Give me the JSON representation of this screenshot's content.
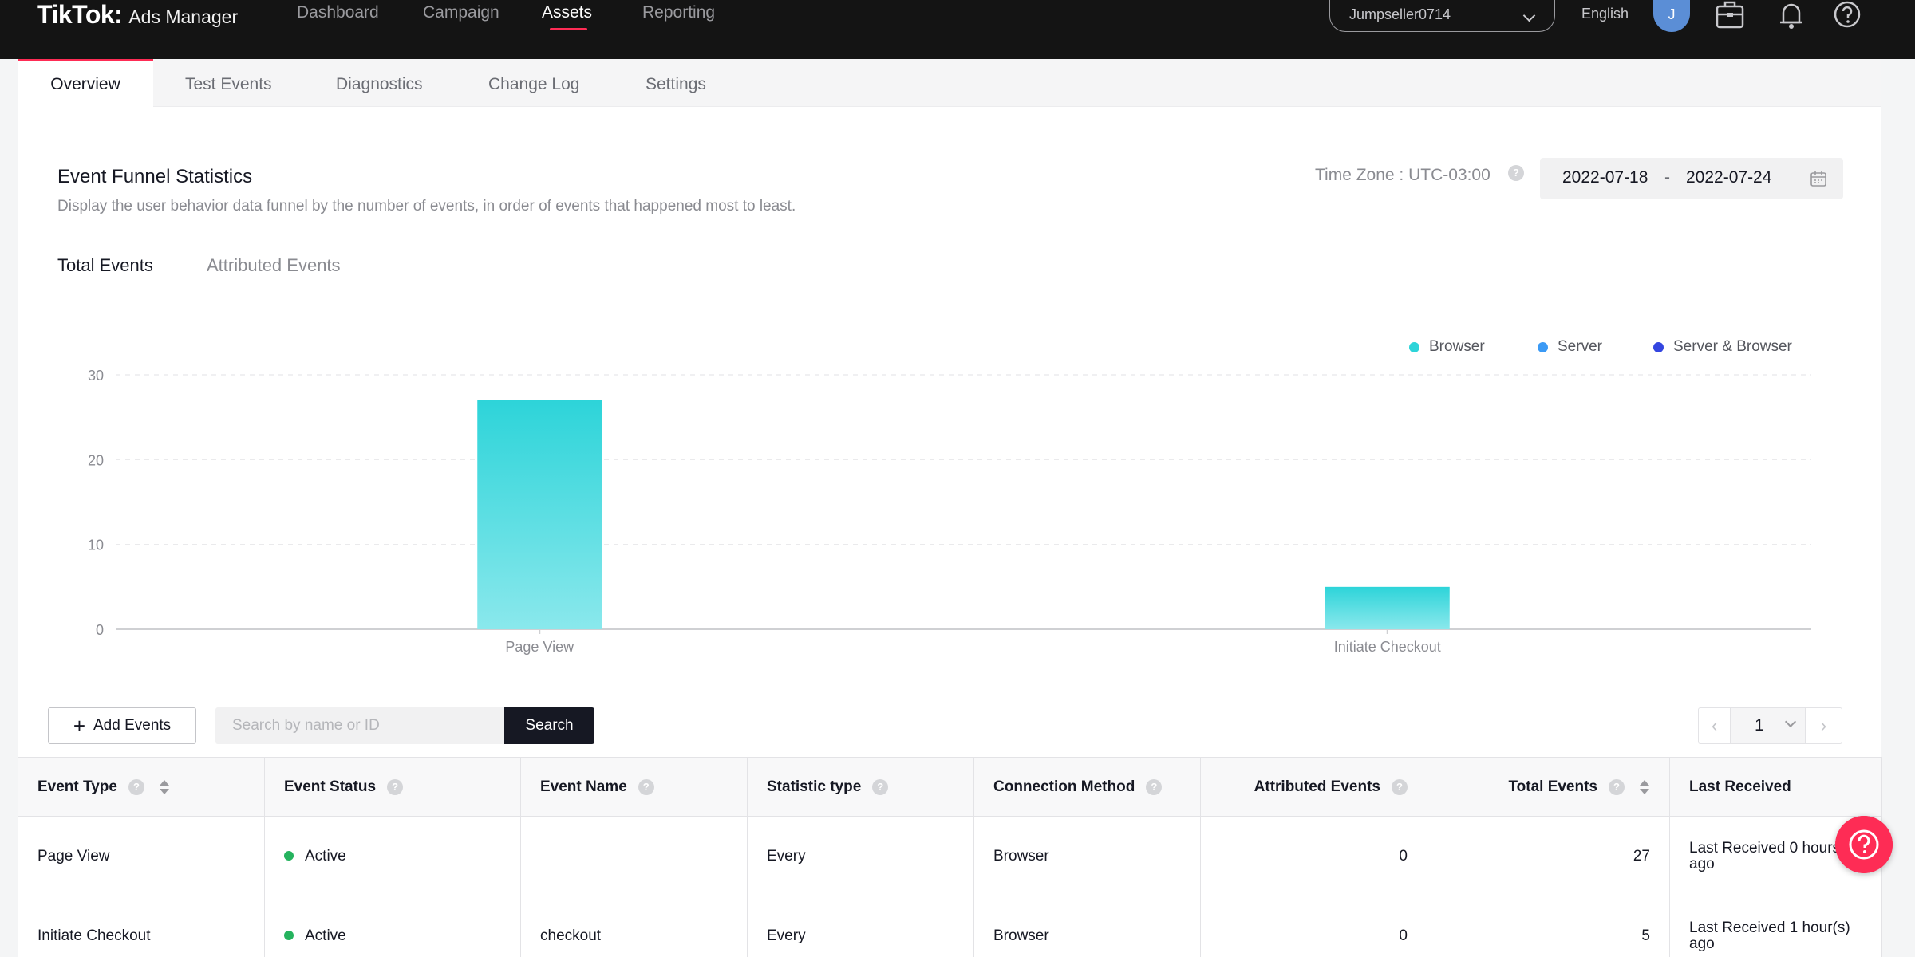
{
  "header": {
    "logo_main": "TikTok:",
    "logo_sub": "Ads Manager",
    "nav": [
      {
        "label": "Dashboard"
      },
      {
        "label": "Campaign"
      },
      {
        "label": "Assets"
      },
      {
        "label": "Reporting"
      }
    ],
    "active_nav": "Assets",
    "account": "Jumpseller0714",
    "language": "English",
    "avatar_initial": "J",
    "icons": [
      "briefcase-icon",
      "bell-icon",
      "help-circle-icon"
    ]
  },
  "tabs": [
    "Overview",
    "Test Events",
    "Diagnostics",
    "Change Log",
    "Settings"
  ],
  "active_tab": "Overview",
  "funnel": {
    "title": "Event Funnel Statistics",
    "description": "Display the user behavior data funnel by the number of events, in order of events that happened most to least.",
    "timezone": "Time Zone : UTC-03:00",
    "date_start": "2022-07-18",
    "date_sep": "-",
    "date_end": "2022-07-24",
    "subtabs": [
      "Total Events",
      "Attributed Events"
    ],
    "active_subtab": "Total Events"
  },
  "chart_data": {
    "type": "bar",
    "categories": [
      "Page View",
      "Initiate Checkout"
    ],
    "series": [
      {
        "name": "Browser",
        "values": [
          27,
          5
        ],
        "color": "#2dd4d9"
      },
      {
        "name": "Server",
        "values": [
          0,
          0
        ],
        "color": "#3b9af5"
      },
      {
        "name": "Server & Browser",
        "values": [
          0,
          0
        ],
        "color": "#3446e0"
      }
    ],
    "yticks": [
      0,
      10,
      20,
      30
    ],
    "ylim": [
      0,
      30
    ],
    "grid": true,
    "legend_position": "top-right",
    "title": "",
    "xlabel": "",
    "ylabel": ""
  },
  "toolbar": {
    "add_label": "Add Events",
    "search_placeholder": "Search by name or ID",
    "search_button": "Search",
    "page": "1"
  },
  "table": {
    "columns": [
      "Event Type",
      "Event Status",
      "Event Name",
      "Statistic type",
      "Connection Method",
      "Attributed Events",
      "Total Events",
      "Last Received"
    ],
    "rows": [
      {
        "event_type": "Page View",
        "status": "Active",
        "event_name": "",
        "statistic": "Every",
        "connection": "Browser",
        "attributed": "0",
        "total": "27",
        "last_received_1": "Last Received 0 hours",
        "last_received_2": "ago"
      },
      {
        "event_type": "Initiate Checkout",
        "status": "Active",
        "event_name": "checkout",
        "statistic": "Every",
        "connection": "Browser",
        "attributed": "0",
        "total": "5",
        "last_received_1": "Last Received 1 hour(s)",
        "last_received_2": "ago"
      }
    ]
  },
  "colors": {
    "accent": "#fe2c55",
    "topbar": "#141414",
    "active_status": "#25b35e"
  }
}
